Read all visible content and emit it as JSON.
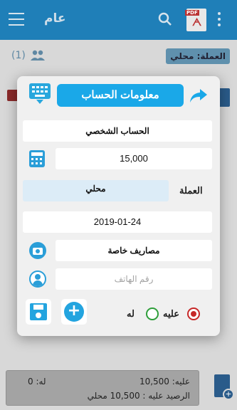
{
  "app": {
    "title": "عام",
    "pdf_tag": "PDF",
    "users_count": "(1)",
    "currency_badge": "العملة: محلي"
  },
  "summary": {
    "debit": "عليه: 10,500",
    "credit": "له: 0",
    "balance": "الرصيد عليه : 10,500 محلي"
  },
  "dialog": {
    "title": "معلومات الحساب",
    "account_name": "الحساب الشخصي",
    "amount": "15,000",
    "currency_label": "العملة",
    "currency_value": "محلي",
    "date": "2019-01-24",
    "category": "مصاريف خاصة",
    "phone_placeholder": "رقم الهاتف",
    "radio_credit_label": "له",
    "radio_debit_label": "عليه",
    "selected_type": "debit"
  },
  "colors": {
    "app_bar": "#1f7fb8",
    "accent": "#1aa8e8",
    "debit_red": "#c62828",
    "credit_green": "#2e9e3a"
  },
  "icons": [
    "menu-icon",
    "search-icon",
    "pdf-icon",
    "more-icon",
    "users-icon",
    "keyboard-icon",
    "share-icon",
    "calculator-icon",
    "pencil-icon",
    "camera-icon",
    "person-icon",
    "save-icon",
    "add-icon",
    "add-file-icon"
  ]
}
